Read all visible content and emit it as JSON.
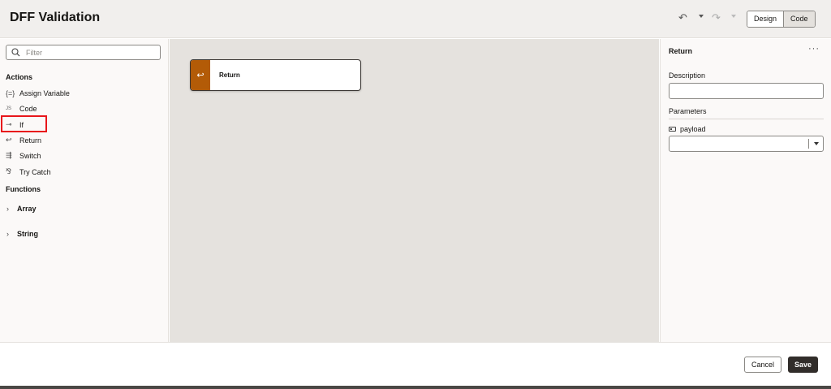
{
  "header": {
    "title": "DFF Validation",
    "undo_icon": "undo-icon",
    "redo_icon": "redo-icon",
    "view_toggle": [
      "Design",
      "Code"
    ],
    "active_view": "Code"
  },
  "sidebar": {
    "search_placeholder": "Filter",
    "actions_heading": "Actions",
    "actions": [
      {
        "label": "Assign Variable",
        "icon": "{=}"
      },
      {
        "label": "Code",
        "icon": "JS"
      },
      {
        "label": "If",
        "icon": "⊸"
      },
      {
        "label": "Return",
        "icon": "↩"
      },
      {
        "label": "Switch",
        "icon": "⇶"
      },
      {
        "label": "Try Catch",
        "icon": "⅋"
      }
    ],
    "functions_heading": "Functions",
    "functions": [
      {
        "label": "Array"
      },
      {
        "label": "String"
      }
    ]
  },
  "canvas": {
    "node": {
      "label": "Return",
      "icon": "↩",
      "color": "#b35b07"
    }
  },
  "properties": {
    "title": "Return",
    "more_icon": "···",
    "description_label": "Description",
    "description_value": "",
    "parameters_label": "Parameters",
    "param_name": "payload",
    "param_value": ""
  },
  "footer": {
    "cancel_label": "Cancel",
    "save_label": "Save"
  }
}
